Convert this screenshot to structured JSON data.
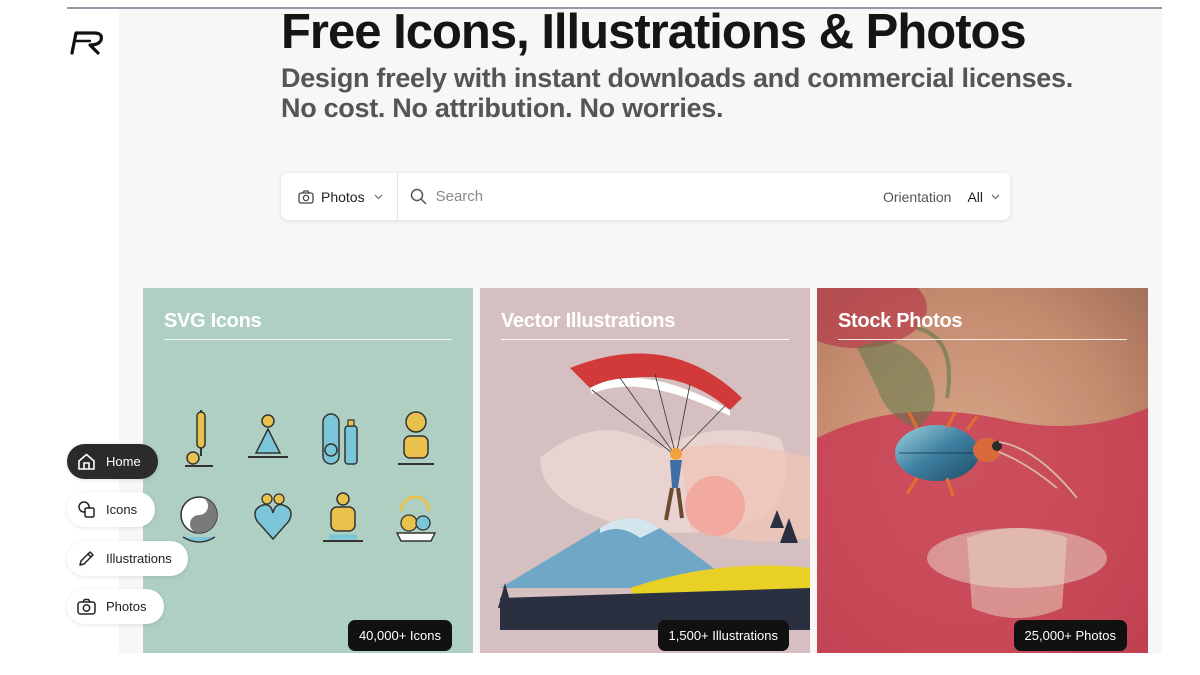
{
  "hero": {
    "title": "Free Icons, Illustrations & Photos",
    "subtitle_line1": "Design freely with instant downloads and commercial licenses.",
    "subtitle_line2": "No cost. No attribution. No worries."
  },
  "search": {
    "type_label": "Photos",
    "placeholder": "Search",
    "orientation_label": "Orientation",
    "orientation_value": "All"
  },
  "cards": [
    {
      "title": "SVG Icons",
      "count": "40,000+ Icons"
    },
    {
      "title": "Vector Illustrations",
      "count": "1,500+ Illustrations"
    },
    {
      "title": "Stock Photos",
      "count": "25,000+ Photos"
    }
  ],
  "nav": {
    "items": [
      {
        "label": "Home",
        "icon": "home-icon",
        "active": true
      },
      {
        "label": "Icons",
        "icon": "shapes-icon",
        "active": false
      },
      {
        "label": "Illustrations",
        "icon": "pencil-icon",
        "active": false
      },
      {
        "label": "Photos",
        "icon": "camera-icon",
        "active": false
      }
    ]
  },
  "colors": {
    "icons_card": "#aecfc2",
    "illustrations_card": "#d6bfc0",
    "photos_card": "#c89a86",
    "badge": "#111111",
    "nav_active": "#2b2b2b"
  }
}
